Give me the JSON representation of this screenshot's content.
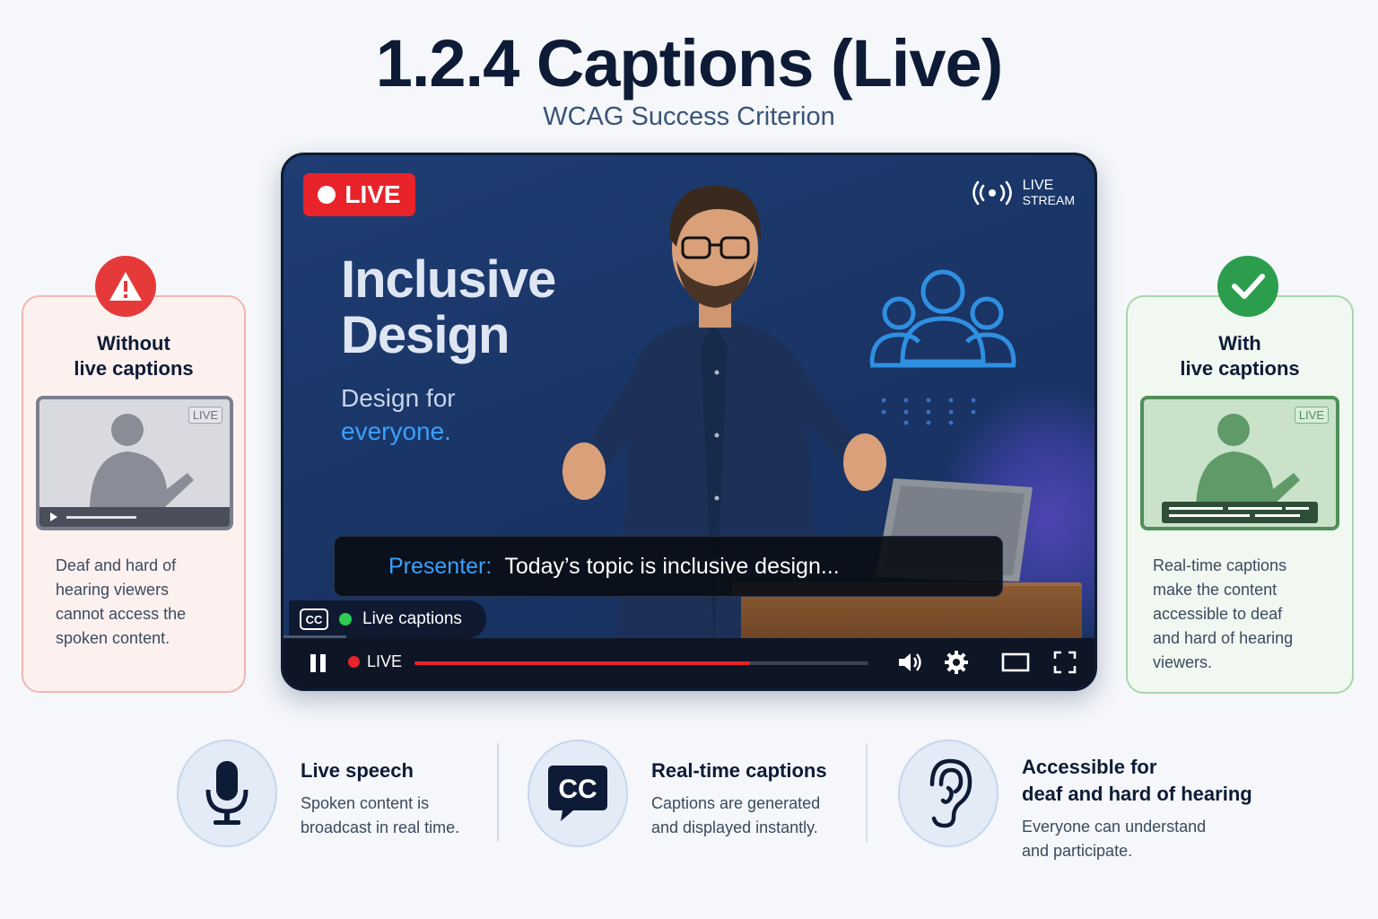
{
  "header": {
    "title": "1.2.4 Captions (Live)",
    "subtitle": "WCAG Success Criterion"
  },
  "player": {
    "live_badge": "LIVE",
    "stream_tag_line1": "LIVE",
    "stream_tag_line2": "STREAM",
    "slide_title_line1": "Inclusive",
    "slide_title_line2": "Design",
    "slide_sub_line1": "Design for",
    "slide_sub_line2": "everyone.",
    "caption_speaker": "Presenter:",
    "caption_text": "Today’s topic is inclusive design...",
    "cc_label": "CC",
    "captions_status": "Live captions",
    "controls_live": "LIVE",
    "progress": 0.74
  },
  "cards": {
    "without": {
      "heading_line1": "Without",
      "heading_line2": "live captions",
      "thumb_live": "LIVE",
      "body": [
        "Deaf and hard of",
        "hearing viewers",
        "cannot access the",
        "spoken content."
      ]
    },
    "with": {
      "heading_line1": "With",
      "heading_line2": "live captions",
      "thumb_live": "LIVE",
      "body": [
        "Real-time captions",
        "make the content",
        "accessible to deaf",
        "and hard of hearing",
        "viewers."
      ]
    }
  },
  "features": [
    {
      "icon": "microphone-icon",
      "title": "Live speech",
      "desc_line1": "Spoken content is",
      "desc_line2": "broadcast in real time."
    },
    {
      "icon": "cc-icon",
      "title": "Real-time captions",
      "desc_line1": "Captions are generated",
      "desc_line2": "and displayed instantly."
    },
    {
      "icon": "ear-icon",
      "title_line1": "Accessible for",
      "title_line2": "deaf and hard of hearing",
      "desc_line1": "Everyone can understand",
      "desc_line2": "and participate."
    }
  ],
  "colors": {
    "accent_red": "#e8232a",
    "accent_blue": "#3aa0ff",
    "success_green": "#2c9d4d",
    "navy": "#0d1b36"
  }
}
